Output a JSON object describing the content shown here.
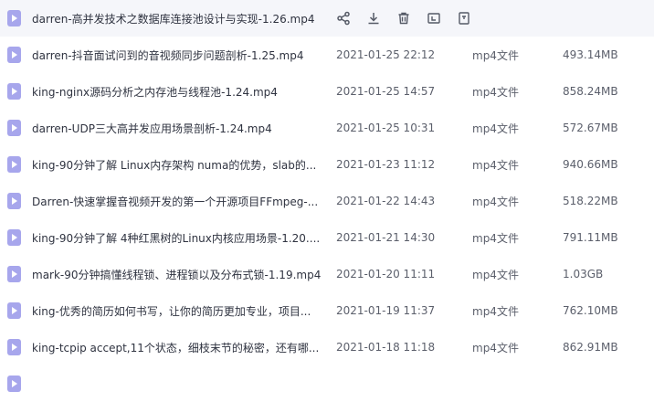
{
  "files": [
    {
      "name": "darren-高并发技术之数据库连接池设计与实现-1.26.mp4",
      "time": "",
      "type": "",
      "size": "",
      "hover": true
    },
    {
      "name": "darren-抖音面试问到的音视频同步问题剖析-1.25.mp4",
      "time": "2021-01-25 22:12",
      "type": "mp4文件",
      "size": "493.14MB"
    },
    {
      "name": "king-nginx源码分析之内存池与线程池-1.24.mp4",
      "time": "2021-01-25 14:57",
      "type": "mp4文件",
      "size": "858.24MB"
    },
    {
      "name": "darren-UDP三大高并发应用场景剖析-1.24.mp4",
      "time": "2021-01-25 10:31",
      "type": "mp4文件",
      "size": "572.67MB"
    },
    {
      "name": "king-90分钟了解 Linux内存架构 numa的优势，slab的...",
      "time": "2021-01-23 11:12",
      "type": "mp4文件",
      "size": "940.66MB"
    },
    {
      "name": "Darren-快速掌握音视频开发的第一个开源项目FFmpeg-...",
      "time": "2021-01-22 14:43",
      "type": "mp4文件",
      "size": "518.22MB"
    },
    {
      "name": "king-90分钟了解 4种红黑树的Linux内核应用场景-1.20....",
      "time": "2021-01-21 14:30",
      "type": "mp4文件",
      "size": "791.11MB"
    },
    {
      "name": "mark-90分钟搞懂线程锁、进程锁以及分布式锁-1.19.mp4",
      "time": "2021-01-20 11:11",
      "type": "mp4文件",
      "size": "1.03GB"
    },
    {
      "name": "king-优秀的简历如何书写，让你的简历更加专业，项目...",
      "time": "2021-01-19 11:37",
      "type": "mp4文件",
      "size": "762.10MB"
    },
    {
      "name": "king-tcpip accept,11个状态，细枝末节的秘密，还有哪...",
      "time": "2021-01-18 11:18",
      "type": "mp4文件",
      "size": "862.91MB"
    }
  ],
  "row_actions": [
    "share-icon",
    "download-icon",
    "delete-icon",
    "rename-icon",
    "more-icon"
  ],
  "colors": {
    "file_icon": "#a7a6ec",
    "hover_row": "#f5f6fa",
    "action_icon": "#555a66"
  }
}
